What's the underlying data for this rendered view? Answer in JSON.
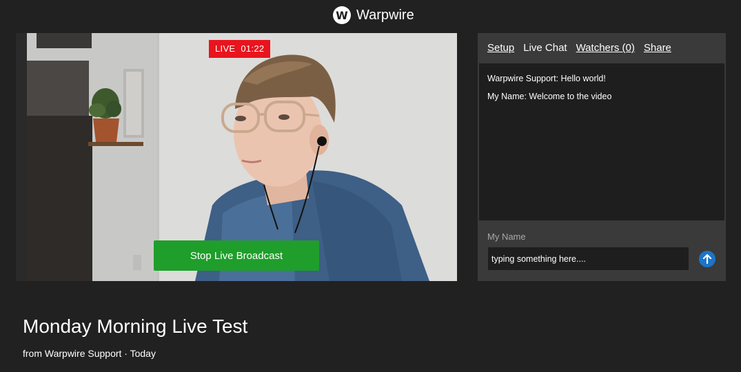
{
  "app": {
    "brand_name": "Warpwire",
    "logo_letter": "W"
  },
  "broadcast": {
    "live_label": "LIVE",
    "elapsed": "01:22",
    "stop_label": "Stop Live Broadcast"
  },
  "chat": {
    "tabs": [
      {
        "label": "Setup"
      },
      {
        "label": "Live Chat"
      },
      {
        "label": "Watchers (0)"
      },
      {
        "label": "Share"
      }
    ],
    "messages": [
      {
        "text": "Warpwire Support: Hello world!"
      },
      {
        "text": "My Name: Welcome to the video"
      }
    ],
    "name_label": "My Name",
    "input_value": "typing something here...."
  },
  "video_info": {
    "title": "Monday Morning Live Test",
    "byline": "from Warpwire Support · Today"
  },
  "colors": {
    "background": "#212121",
    "live_badge": "#e8141e",
    "stop_button": "#1f9e2b",
    "send_button": "#1d74c9",
    "panel": "#3a3a3a"
  },
  "icons": {
    "send": "arrow-up-icon",
    "logo": "warpwire-logo-icon"
  }
}
